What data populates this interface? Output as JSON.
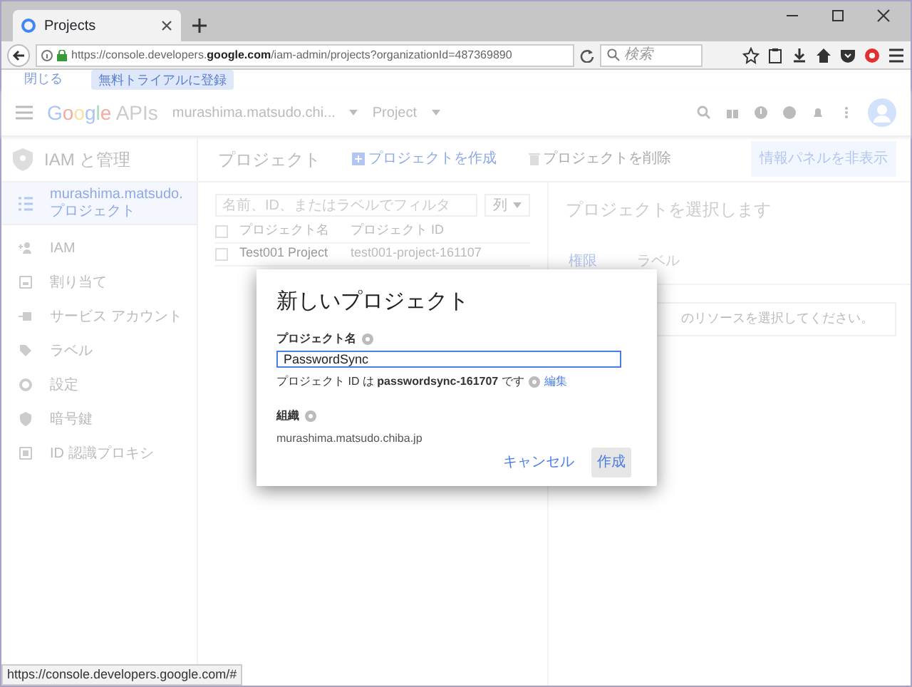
{
  "browser": {
    "tab_title": "Projects",
    "url_prefix": "https://console.developers.",
    "url_domain": "google.com",
    "url_rest": "/iam-admin/projects?organizationId=487369890",
    "search_placeholder": "検索"
  },
  "promo": {
    "close_link": "閉じる",
    "trial_button": "無料トライアルに登録"
  },
  "header": {
    "logo_letters": [
      "G",
      "o",
      "o",
      "g",
      "l",
      "e"
    ],
    "logo_suffix": "APIs",
    "account": "murashima.matsudo.chi...",
    "project_selector": "Project"
  },
  "sidebar": {
    "title": "IAM と管理",
    "items": [
      {
        "label": "murashima.matsudo.プロジェクト",
        "selected": true
      },
      {
        "label": "IAM",
        "selected": false
      },
      {
        "label": "割り当て",
        "selected": false
      },
      {
        "label": "サービス アカウント",
        "selected": false
      },
      {
        "label": "ラベル",
        "selected": false
      },
      {
        "label": "設定",
        "selected": false
      },
      {
        "label": "暗号鍵",
        "selected": false
      },
      {
        "label": "ID 認識プロキシ",
        "selected": false
      }
    ]
  },
  "main": {
    "title": "プロジェクト",
    "actions": [
      {
        "label": "プロジェクトを作成",
        "disabled": false
      },
      {
        "label": "プロジェクトを削除",
        "disabled": true
      }
    ],
    "info_panel_button": "情報パネルを非表示"
  },
  "filter": {
    "placeholder": "名前、ID、またはラベルでフィルタ",
    "columns_button": "列"
  },
  "table": {
    "select_all_checked": false,
    "columns": [
      "プロジェクト名",
      "プロジェクト ID"
    ],
    "rows": [
      {
        "checked": false,
        "cells": [
          "Test001 Project",
          "test001-project-161107"
        ]
      }
    ]
  },
  "info_panel": {
    "title": "プロジェクトを選択します",
    "tabs": [
      {
        "label": "権限",
        "selected": true
      },
      {
        "label": "ラベル",
        "selected": false
      }
    ],
    "message": "のリソースを選択してください。"
  },
  "dialog": {
    "title": "新しいプロジェクト",
    "name_label": "プロジェクト名",
    "name_value": "PasswordSync",
    "id_hint": "プロジェクト ID は **passwordsync-161707** です",
    "edit_link": "編集",
    "org_label": "組織",
    "org_value": "murashima.matsudo.chiba.jp",
    "buttons": [
      {
        "label": "キャンセル",
        "hovered": false
      },
      {
        "label": "作成",
        "hovered": true
      }
    ]
  },
  "status_bar": "https://console.developers.google.com/#"
}
